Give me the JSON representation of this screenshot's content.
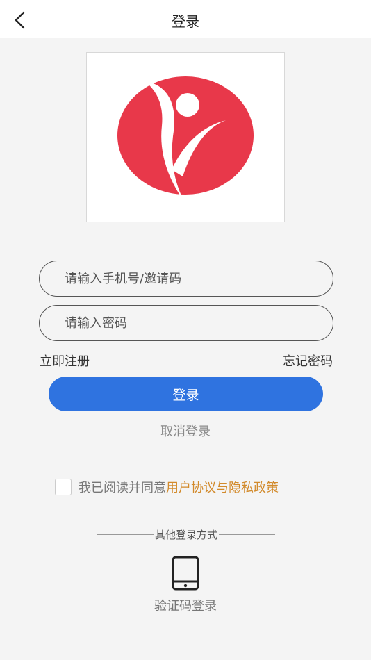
{
  "header": {
    "title": "登录",
    "back_icon": "chevron-left-icon"
  },
  "logo": {
    "brand_color": "#e8384a"
  },
  "form": {
    "phone_placeholder": "请输入手机号/邀请码",
    "password_placeholder": "请输入密码",
    "register_label": "立即注册",
    "forgot_label": "忘记密码",
    "login_label": "登录",
    "cancel_label": "取消登录"
  },
  "agreement": {
    "checked": false,
    "prefix": "我已阅读并同意",
    "user_agreement": "用户协议",
    "and": "与",
    "privacy_policy": "隐私政策",
    "link_color": "#d28a2b"
  },
  "other_login": {
    "divider_text": "其他登录方式",
    "sms_label": "验证码登录",
    "sms_icon": "phone-icon"
  },
  "colors": {
    "primary": "#2f73e0",
    "background": "#f4f4f4"
  }
}
